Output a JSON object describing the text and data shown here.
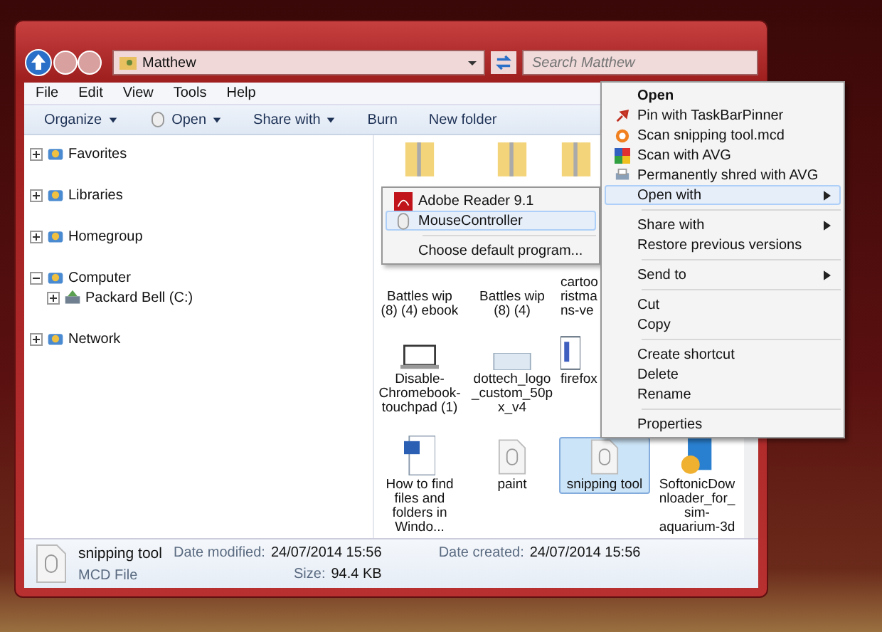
{
  "window": {
    "address": "Matthew",
    "search_placeholder": "Search Matthew"
  },
  "menu_bar": [
    "File",
    "Edit",
    "View",
    "Tools",
    "Help"
  ],
  "toolbar": [
    {
      "label": "Organize",
      "dropdown": true
    },
    {
      "label": "Open",
      "dropdown": true
    },
    {
      "label": "Share with",
      "dropdown": true
    },
    {
      "label": "Burn",
      "dropdown": false
    },
    {
      "label": "New folder",
      "dropdown": false
    }
  ],
  "sidebar": {
    "items": [
      {
        "label": "Favorites",
        "expanded": false
      },
      {
        "label": "Libraries",
        "expanded": false
      },
      {
        "label": "Homegroup",
        "expanded": false
      },
      {
        "label": "Computer",
        "expanded": true,
        "children": [
          {
            "label": "Packard Bell (C:)",
            "expanded": false
          }
        ]
      },
      {
        "label": "Network",
        "expanded": false
      }
    ]
  },
  "file_rows": [
    {
      "items": [
        {
          "selected": false
        },
        {
          "selected": false
        },
        {
          "selected": false
        }
      ]
    },
    {
      "items": [
        {
          "label": "Battles wip (8) (4) ebook",
          "selected": false
        },
        {
          "label": "Battles wip (8) (4)",
          "selected": false
        },
        {
          "label": "cartoo ristma ns-ve",
          "selected": false
        }
      ]
    },
    {
      "items": [
        {
          "label": "Disable-Chromebook-touchpad (1)",
          "selected": false
        },
        {
          "label": "dottech_logo_custom_50px_v4",
          "selected": false
        },
        {
          "label": "firefox",
          "selected": false
        }
      ]
    },
    {
      "items": [
        {
          "label": "How to find files and folders in Windo...",
          "selected": false
        },
        {
          "label": "paint",
          "selected": false
        },
        {
          "label": "snipping tool",
          "selected": true
        },
        {
          "label": "SoftonicDownloader_for_sim-aquarium-3d",
          "selected": false
        }
      ]
    }
  ],
  "details": {
    "name": "snipping tool",
    "type": "MCD File",
    "fields": [
      {
        "label": "Date modified:",
        "value": "24/07/2014 15:56"
      },
      {
        "label": "Size:",
        "value": "94.4 KB"
      },
      {
        "label": "Date created:",
        "value": "24/07/2014 15:56"
      }
    ]
  },
  "context_menu": {
    "items": [
      {
        "kind": "item",
        "label": "Open",
        "default": true,
        "submenu": false,
        "selected": false
      },
      {
        "kind": "item",
        "label": "Pin with TaskBarPinner",
        "default": false,
        "submenu": false,
        "selected": false
      },
      {
        "kind": "item",
        "label": "Scan snipping tool.mcd",
        "default": false,
        "submenu": false,
        "selected": false
      },
      {
        "kind": "item",
        "label": "Scan with AVG",
        "default": false,
        "submenu": false,
        "selected": false
      },
      {
        "kind": "item",
        "label": "Permanently shred with AVG",
        "default": false,
        "submenu": false,
        "selected": false
      },
      {
        "kind": "item",
        "label": "Open with",
        "default": false,
        "submenu": true,
        "selected": true
      },
      {
        "kind": "separator"
      },
      {
        "kind": "item",
        "label": "Share with",
        "default": false,
        "submenu": true,
        "selected": false
      },
      {
        "kind": "item",
        "label": "Restore previous versions",
        "default": false,
        "submenu": false,
        "selected": false
      },
      {
        "kind": "separator"
      },
      {
        "kind": "item",
        "label": "Send to",
        "default": false,
        "submenu": true,
        "selected": false
      },
      {
        "kind": "separator"
      },
      {
        "kind": "item",
        "label": "Cut",
        "default": false,
        "submenu": false,
        "selected": false
      },
      {
        "kind": "item",
        "label": "Copy",
        "default": false,
        "submenu": false,
        "selected": false
      },
      {
        "kind": "separator"
      },
      {
        "kind": "item",
        "label": "Create shortcut",
        "default": false,
        "submenu": false,
        "selected": false
      },
      {
        "kind": "item",
        "label": "Delete",
        "default": false,
        "submenu": false,
        "selected": false
      },
      {
        "kind": "item",
        "label": "Rename",
        "default": false,
        "submenu": false,
        "selected": false
      },
      {
        "kind": "separator"
      },
      {
        "kind": "item",
        "label": "Properties",
        "default": false,
        "submenu": false,
        "selected": false
      }
    ]
  },
  "open_with_menu": {
    "items": [
      {
        "kind": "item",
        "label": "Adobe Reader 9.1",
        "selected": false
      },
      {
        "kind": "item",
        "label": "MouseController",
        "selected": true
      },
      {
        "kind": "separator"
      },
      {
        "kind": "item",
        "label": "Choose default program...",
        "selected": false
      }
    ]
  }
}
